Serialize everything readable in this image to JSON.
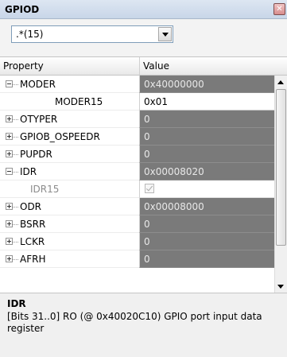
{
  "window": {
    "title": "GPIOD",
    "close_icon": "close-icon"
  },
  "filter": {
    "value": ".*(15)"
  },
  "grid": {
    "columns": [
      "Property",
      "Value"
    ],
    "rows": [
      {
        "name": "MODER",
        "value": "0x40000000",
        "expander": "minus"
      },
      {
        "name": "MODER15",
        "value": "0x01",
        "expander": "none"
      },
      {
        "name": "OTYPER",
        "value": "0",
        "expander": "plus"
      },
      {
        "name": "GPIOB_OSPEEDR",
        "value": "0",
        "expander": "plus"
      },
      {
        "name": "PUPDR",
        "value": "0",
        "expander": "plus"
      },
      {
        "name": "IDR",
        "value": "0x00008020",
        "expander": "minus"
      },
      {
        "name": "IDR15",
        "value": "checked",
        "expander": "none"
      },
      {
        "name": "ODR",
        "value": "0x00008000",
        "expander": "plus"
      },
      {
        "name": "BSRR",
        "value": "0",
        "expander": "plus"
      },
      {
        "name": "LCKR",
        "value": "0",
        "expander": "plus"
      },
      {
        "name": "AFRH",
        "value": "0",
        "expander": "plus"
      }
    ]
  },
  "description": {
    "title": "IDR",
    "text": "[Bits 31..0] RO (@ 0x40020C10) GPIO port input data register"
  }
}
